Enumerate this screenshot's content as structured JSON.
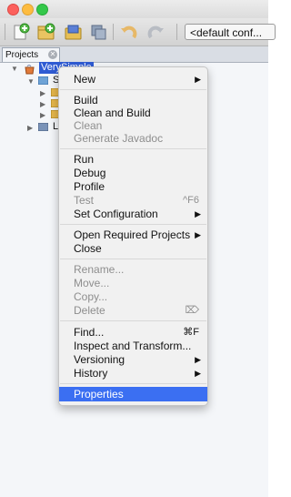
{
  "config_select": {
    "value": "<default conf..."
  },
  "panel": {
    "tab_label": "Projects"
  },
  "tree": {
    "root_label": "VerySimple",
    "children": [
      {
        "label": "S"
      },
      {
        "label": ""
      },
      {
        "label": ""
      },
      {
        "label": ""
      },
      {
        "label": "L"
      }
    ]
  },
  "menu": {
    "items": [
      {
        "label": "New",
        "shortcut": "",
        "submenu": true,
        "disabled": false
      },
      {
        "label": "Build",
        "shortcut": "",
        "submenu": false,
        "disabled": false
      },
      {
        "label": "Clean and Build",
        "shortcut": "",
        "submenu": false,
        "disabled": false
      },
      {
        "label": "Clean",
        "shortcut": "",
        "submenu": false,
        "disabled": true
      },
      {
        "label": "Generate Javadoc",
        "shortcut": "",
        "submenu": false,
        "disabled": true
      },
      {
        "label": "Run",
        "shortcut": "",
        "submenu": false,
        "disabled": false
      },
      {
        "label": "Debug",
        "shortcut": "",
        "submenu": false,
        "disabled": false
      },
      {
        "label": "Profile",
        "shortcut": "",
        "submenu": false,
        "disabled": false
      },
      {
        "label": "Test",
        "shortcut": "^F6",
        "submenu": false,
        "disabled": true
      },
      {
        "label": "Set Configuration",
        "shortcut": "",
        "submenu": true,
        "disabled": false
      },
      {
        "label": "Open Required Projects",
        "shortcut": "",
        "submenu": true,
        "disabled": false
      },
      {
        "label": "Close",
        "shortcut": "",
        "submenu": false,
        "disabled": false
      },
      {
        "label": "Rename...",
        "shortcut": "",
        "submenu": false,
        "disabled": true
      },
      {
        "label": "Move...",
        "shortcut": "",
        "submenu": false,
        "disabled": true
      },
      {
        "label": "Copy...",
        "shortcut": "",
        "submenu": false,
        "disabled": true
      },
      {
        "label": "Delete",
        "shortcut": "⌦",
        "submenu": false,
        "disabled": true
      },
      {
        "label": "Find...",
        "shortcut": "⌘F",
        "submenu": false,
        "disabled": false
      },
      {
        "label": "Inspect and Transform...",
        "shortcut": "",
        "submenu": false,
        "disabled": false
      },
      {
        "label": "Versioning",
        "shortcut": "",
        "submenu": true,
        "disabled": false
      },
      {
        "label": "History",
        "shortcut": "",
        "submenu": true,
        "disabled": false
      },
      {
        "label": "Properties",
        "shortcut": "",
        "submenu": false,
        "disabled": false,
        "selected": true
      }
    ]
  },
  "colors": {
    "selection": "#3b6ff2",
    "tree_selection": "#2f5bd3"
  }
}
